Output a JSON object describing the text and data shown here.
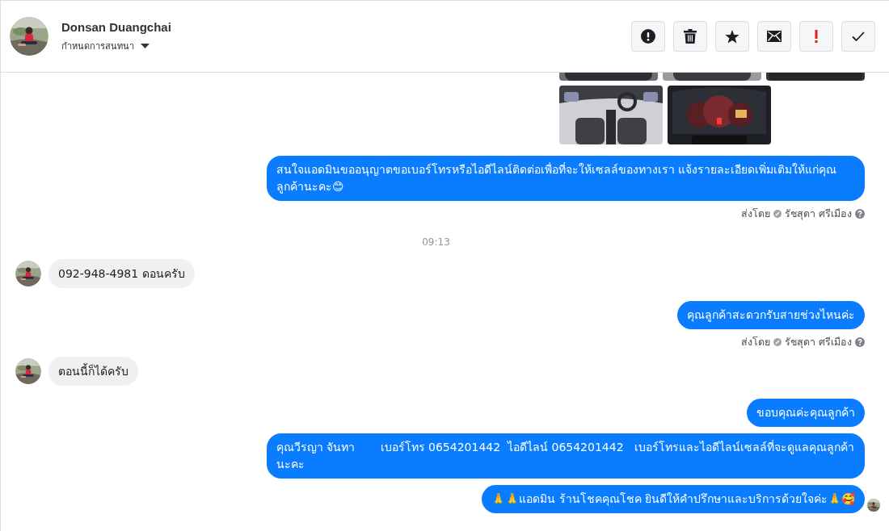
{
  "header": {
    "name": "Donsan Duangchai",
    "subtitle": "กำหนดการสนทนา",
    "actions": [
      {
        "kind": "alert"
      },
      {
        "kind": "trash"
      },
      {
        "kind": "star"
      },
      {
        "kind": "mail"
      },
      {
        "kind": "flag"
      },
      {
        "kind": "check"
      }
    ]
  },
  "messages": [
    {
      "kind": "photos",
      "rows": [
        {
          "clipped": true
        },
        {
          "clipped": false
        }
      ]
    },
    {
      "kind": "outgoing",
      "text": "สนใจแอดมินขออนุญาตขอเบอร์โทรหรือไอดีไลน์ติดต่อเพื่อที่จะให้เซลล์ของทางเรา แจ้งรายละเอียดเพิ่มเติมให้แก่คุณลูกค้านะคะ😊",
      "seen": false
    },
    {
      "kind": "sent_by",
      "label": "ส่งโดย",
      "sender": "รัชสุดา ศรีเมือง"
    },
    {
      "kind": "time",
      "text": "09:13"
    },
    {
      "kind": "incoming",
      "text": "092-948-4981 ดอนครับ"
    },
    {
      "kind": "outgoing",
      "text": "คุณลูกค้าสะดวกรับสายช่วงไหนค่ะ",
      "seen": false
    },
    {
      "kind": "sent_by",
      "label": "ส่งโดย",
      "sender": "รัชสุดา ศรีเมือง"
    },
    {
      "kind": "incoming",
      "text": "ตอนนี้ก็ได้ครับ"
    },
    {
      "kind": "outgoing",
      "text": "ขอบคุณค่ะคุณลูกค้า",
      "seen": false
    },
    {
      "kind": "outgoing",
      "text": "คุณวีรญา จันทา       เบอร์โทร 0654201442  ไอดีไลน์ 0654201442   เบอร์โทรและไอดีไลน์เซลล์ที่จะดูแลคุณลูกค้านะคะ",
      "seen": false
    },
    {
      "kind": "outgoing",
      "text": "🙏🙏แอดมิน ร้านโชคคุณโชค ยินดีให้คำปรึกษาและบริการด้วยใจค่ะ🙏🥰",
      "seen": true
    }
  ]
}
